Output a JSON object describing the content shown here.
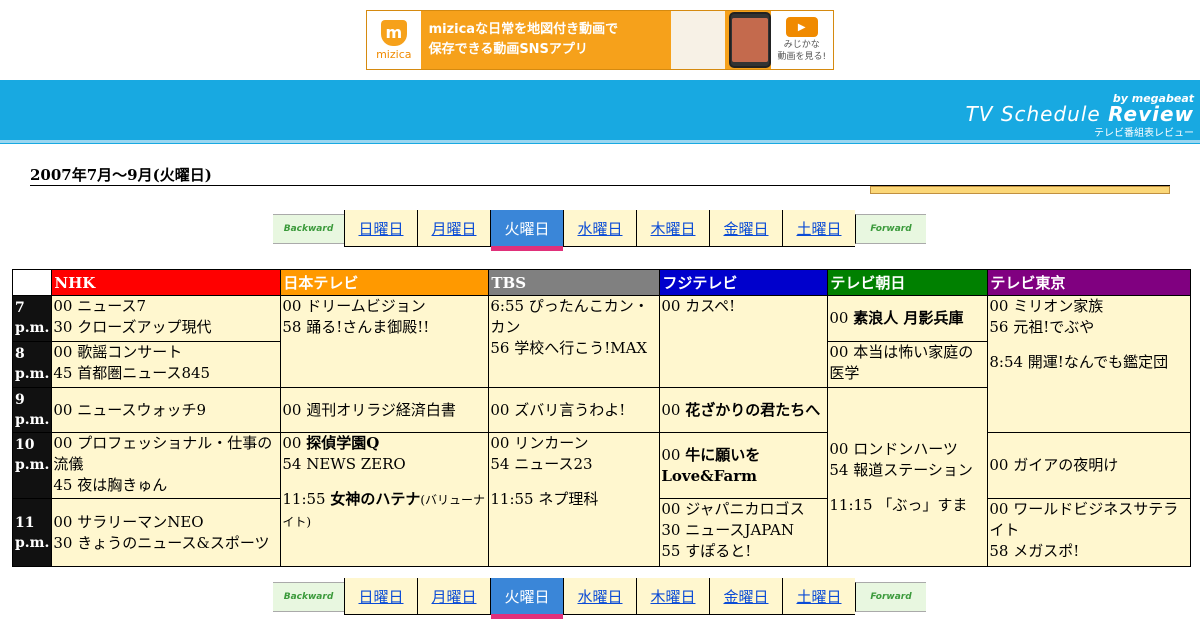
{
  "ad": {
    "logo_text": "mizica",
    "copy_line1": "mizicaな日常を地図付き動画で",
    "copy_line2": "保存できる動画SNSアプリ",
    "cta_line1": "みじかな",
    "cta_line2": "動画を見る!"
  },
  "header": {
    "by": "by megabeat",
    "title_a": "TV Schedule ",
    "title_b": "Review",
    "sub": "テレビ番組表レビュー"
  },
  "page": {
    "title": "2007年7月～9月(火曜日)"
  },
  "daynav": {
    "backward": "Backward",
    "forward": "Forward",
    "days": [
      "日曜日",
      "月曜日",
      "火曜日",
      "水曜日",
      "木曜日",
      "金曜日",
      "土曜日"
    ],
    "active": "火曜日"
  },
  "channels": [
    {
      "name": "NHK",
      "color": "#ff0000"
    },
    {
      "name": "日本テレビ",
      "color": "#ff9900"
    },
    {
      "name": "TBS",
      "color": "#808080"
    },
    {
      "name": "フジテレビ",
      "color": "#0000cc"
    },
    {
      "name": "テレビ朝日",
      "color": "#008000"
    },
    {
      "name": "テレビ東京",
      "color": "#800080"
    }
  ],
  "times": [
    "7 p.m.",
    "8 p.m.",
    "9 p.m.",
    "10 p.m.",
    "11 p.m."
  ],
  "programs": {
    "nhk_7_a": "00 ニュース7",
    "nhk_7_b": "30 クローズアップ現代",
    "nhk_8_a": "00 歌謡コンサート",
    "nhk_8_b": "45 首都圏ニュース845",
    "nhk_9": "00 ニュースウォッチ9",
    "nhk_10_a": "00 プロフェッショナル・仕事の流儀",
    "nhk_10_b": "45 夜は胸きゅん",
    "nhk_11_a": "00 サラリーマンNEO",
    "nhk_11_b": "30 きょうのニュース&スポーツ",
    "ntv_7_a": "00 ドリームビジョン",
    "ntv_7_b": "58 踊る!さんま御殿!!",
    "ntv_9": "00 週刊オリラジ経済白書",
    "ntv_10_a_pre": "00 ",
    "ntv_10_a": "探偵学園Q",
    "ntv_10_b": "54 NEWS ZERO",
    "ntv_11_pre": "11:55 ",
    "ntv_11": "女神のハテナ",
    "ntv_11_note": "(バリューナイト)",
    "tbs_7_a": "6:55 ぴったんこカン・カン",
    "tbs_7_b": "56 学校へ行こう!MAX",
    "tbs_9": "00 ズバリ言うわよ!",
    "tbs_10_a": "00 リンカーン",
    "tbs_10_b": "54 ニュース23",
    "tbs_11": "11:55 ネプ理科",
    "cx_7": "00 カスペ!",
    "cx_9_pre": "00 ",
    "cx_9": "花ざかりの君たちへ",
    "cx_10_pre": "00 ",
    "cx_10": "牛に願いを Love&Farm",
    "cx_11_a": "00 ジャパニカロゴス",
    "cx_11_b": "30 ニュースJAPAN",
    "cx_11_c": "55 すぽると!",
    "ex_7_pre": "00 ",
    "ex_7": "素浪人 月影兵庫",
    "ex_8": "00 本当は怖い家庭の医学",
    "ex_9_a": "00 ロンドンハーツ",
    "ex_9_b": "54 報道ステーション",
    "ex_9_c": "11:15 「ぶっ」すま",
    "tx_7_a": "00 ミリオン家族",
    "tx_7_b": "56 元祖!でぶや",
    "tx_7_c": "8:54 開運!なんでも鑑定団",
    "tx_10": "00 ガイアの夜明け",
    "tx_11_a": "00 ワールドビジネスサテライト",
    "tx_11_b": "58 メガスポ!"
  }
}
